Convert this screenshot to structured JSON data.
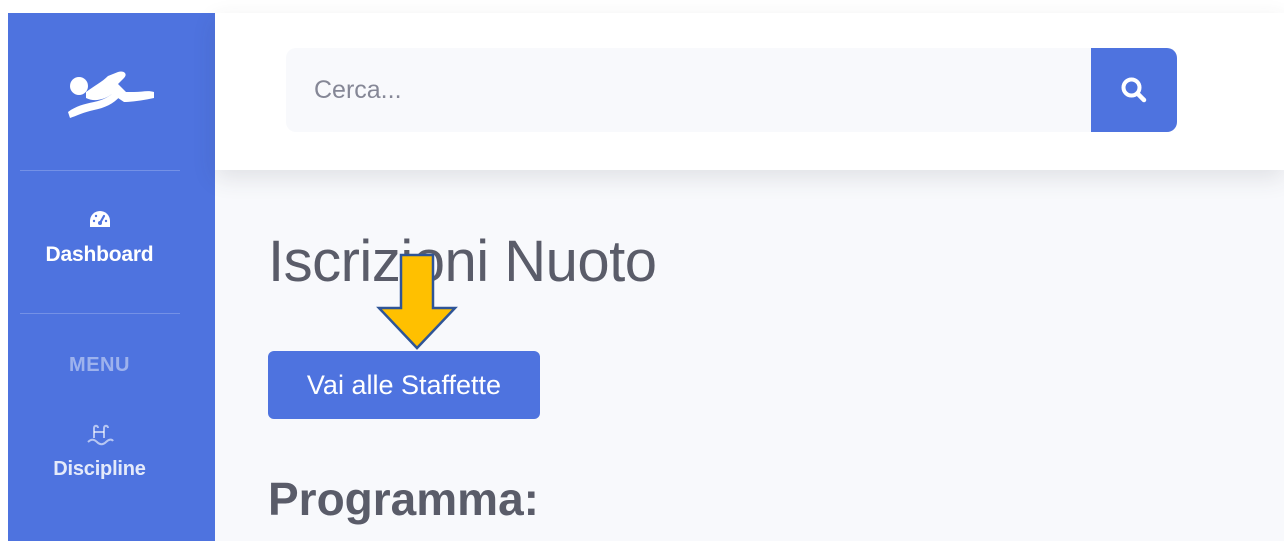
{
  "sidebar": {
    "logo_icon": "swimmer-icon",
    "items": [
      {
        "label": "Dashboard",
        "icon": "tachometer-icon"
      },
      {
        "label": "Discipline",
        "icon": "swimming-pool-icon"
      }
    ],
    "menu_heading": "MENU"
  },
  "topbar": {
    "search": {
      "placeholder": "Cerca...",
      "value": ""
    },
    "search_button_icon": "search-icon"
  },
  "main": {
    "title": "Iscrizioni Nuoto",
    "staffette_button_label": "Vai alle Staffette",
    "programma_heading": "Programma:"
  },
  "annotation": {
    "arrow_icon": "down-arrow-icon",
    "arrow_color": "#FFC000"
  },
  "colors": {
    "primary": "#4e73df",
    "background": "#f8f9fc",
    "text": "#5a5c69"
  }
}
